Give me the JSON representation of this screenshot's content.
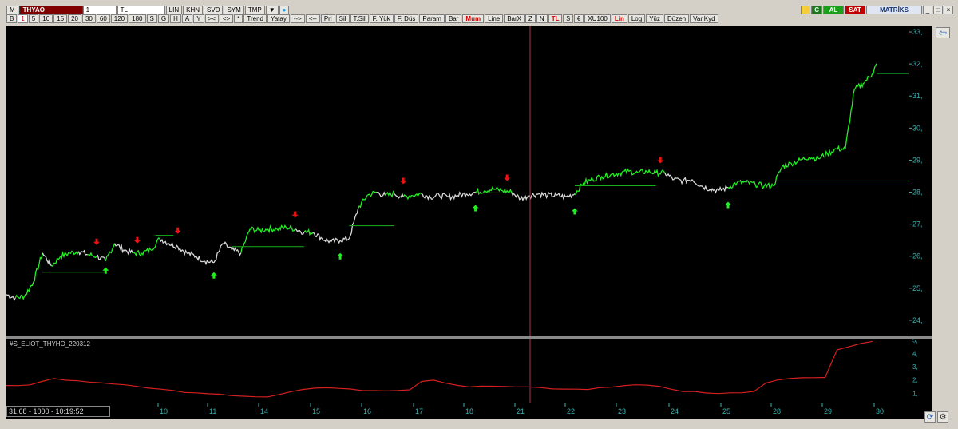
{
  "toolbar": {
    "menu_label": "M",
    "symbol": "THYAO",
    "period": "1",
    "currency": "TL",
    "row1_buttons": [
      "LIN",
      "KHN",
      "SVD",
      "SYM",
      "TMP"
    ],
    "row2_periods": [
      "B",
      "1",
      "5",
      "10",
      "15",
      "20",
      "30",
      "60",
      "120",
      "180",
      "S",
      "G",
      "H",
      "A",
      "Y"
    ],
    "row2_selected": "1",
    "row1_tools": [
      "><",
      "<>",
      "*",
      "Trend",
      "Yatay",
      "-->",
      "<--",
      "Prl",
      "Sil",
      "T.Sil",
      "F. Yük",
      "F. Düş",
      "Param",
      "Bar",
      "Mum",
      "Line",
      "BarX",
      "Z",
      "N",
      "TL",
      "$",
      "€",
      "XU100",
      "Lin",
      "Log",
      "Yüz",
      "Düzen",
      "Var.Kyd"
    ],
    "red_tools": [
      "Mum",
      "TL",
      "Lin"
    ]
  },
  "right_controls": {
    "c_label": "C",
    "al_label": "AL",
    "sat_label": "SAT",
    "brand": "MATRİKS"
  },
  "status_readout": "31,68 - 1000 - 10:19:52",
  "indicator_name": "#S_ELIOT_THYHO_220312",
  "colors": {
    "background": "#000000",
    "price_up": "#22ee22",
    "price_neutral": "#d8d8d8",
    "support_line": "#18b018",
    "indicator": "#d42020",
    "axis_text": "#3ab0b0",
    "crosshair": "#b03050",
    "signal_up": "#22ee22",
    "signal_down": "#ee1111"
  },
  "chart_data": {
    "type": "line",
    "y_axis": {
      "min": 23.5,
      "max": 33.2,
      "ticks": [
        "24,",
        "25,",
        "26,",
        "27,",
        "28,",
        "29,",
        "30,",
        "31,",
        "32,",
        "33,"
      ]
    },
    "x_axis": {
      "ticks": [
        "10",
        "11",
        "14",
        "15",
        "16",
        "17",
        "18",
        "21",
        "22",
        "23",
        "24",
        "25",
        "28",
        "29",
        "30"
      ]
    },
    "price_series": [
      {
        "t": 0,
        "v": 24.8
      },
      {
        "t": 0.01,
        "v": 24.7
      },
      {
        "t": 0.02,
        "v": 24.75
      },
      {
        "t": 0.03,
        "v": 25.2
      },
      {
        "t": 0.04,
        "v": 26.1
      },
      {
        "t": 0.05,
        "v": 25.7
      },
      {
        "t": 0.06,
        "v": 26.0
      },
      {
        "t": 0.07,
        "v": 26.1
      },
      {
        "t": 0.08,
        "v": 26.15
      },
      {
        "t": 0.09,
        "v": 26.05
      },
      {
        "t": 0.1,
        "v": 26.0
      },
      {
        "t": 0.11,
        "v": 25.85
      },
      {
        "t": 0.12,
        "v": 26.4
      },
      {
        "t": 0.13,
        "v": 26.2
      },
      {
        "t": 0.14,
        "v": 26.1
      },
      {
        "t": 0.15,
        "v": 26.1
      },
      {
        "t": 0.16,
        "v": 26.2
      },
      {
        "t": 0.17,
        "v": 26.55
      },
      {
        "t": 0.18,
        "v": 26.4
      },
      {
        "t": 0.19,
        "v": 26.3
      },
      {
        "t": 0.2,
        "v": 26.1
      },
      {
        "t": 0.21,
        "v": 26.0
      },
      {
        "t": 0.22,
        "v": 25.85
      },
      {
        "t": 0.23,
        "v": 25.8
      },
      {
        "t": 0.24,
        "v": 26.4
      },
      {
        "t": 0.25,
        "v": 26.2
      },
      {
        "t": 0.26,
        "v": 26.1
      },
      {
        "t": 0.27,
        "v": 26.85
      },
      {
        "t": 0.28,
        "v": 26.8
      },
      {
        "t": 0.29,
        "v": 26.85
      },
      {
        "t": 0.3,
        "v": 26.85
      },
      {
        "t": 0.31,
        "v": 26.9
      },
      {
        "t": 0.32,
        "v": 26.85
      },
      {
        "t": 0.33,
        "v": 26.75
      },
      {
        "t": 0.34,
        "v": 26.75
      },
      {
        "t": 0.35,
        "v": 26.55
      },
      {
        "t": 0.36,
        "v": 26.45
      },
      {
        "t": 0.37,
        "v": 26.5
      },
      {
        "t": 0.38,
        "v": 26.55
      },
      {
        "t": 0.39,
        "v": 27.5
      },
      {
        "t": 0.4,
        "v": 27.9
      },
      {
        "t": 0.41,
        "v": 28.0
      },
      {
        "t": 0.42,
        "v": 27.9
      },
      {
        "t": 0.43,
        "v": 27.95
      },
      {
        "t": 0.44,
        "v": 27.85
      },
      {
        "t": 0.45,
        "v": 27.9
      },
      {
        "t": 0.46,
        "v": 27.95
      },
      {
        "t": 0.47,
        "v": 27.85
      },
      {
        "t": 0.48,
        "v": 27.9
      },
      {
        "t": 0.49,
        "v": 27.85
      },
      {
        "t": 0.5,
        "v": 27.9
      },
      {
        "t": 0.51,
        "v": 27.95
      },
      {
        "t": 0.52,
        "v": 28.0
      },
      {
        "t": 0.53,
        "v": 28.05
      },
      {
        "t": 0.54,
        "v": 28.1
      },
      {
        "t": 0.55,
        "v": 28.05
      },
      {
        "t": 0.56,
        "v": 28.0
      },
      {
        "t": 0.57,
        "v": 27.8
      },
      {
        "t": 0.58,
        "v": 27.9
      },
      {
        "t": 0.59,
        "v": 27.95
      },
      {
        "t": 0.6,
        "v": 27.9
      },
      {
        "t": 0.61,
        "v": 27.9
      },
      {
        "t": 0.62,
        "v": 27.85
      },
      {
        "t": 0.63,
        "v": 27.95
      },
      {
        "t": 0.64,
        "v": 28.3
      },
      {
        "t": 0.65,
        "v": 28.4
      },
      {
        "t": 0.66,
        "v": 28.5
      },
      {
        "t": 0.67,
        "v": 28.55
      },
      {
        "t": 0.68,
        "v": 28.6
      },
      {
        "t": 0.69,
        "v": 28.65
      },
      {
        "t": 0.7,
        "v": 28.6
      },
      {
        "t": 0.71,
        "v": 28.65
      },
      {
        "t": 0.72,
        "v": 28.6
      },
      {
        "t": 0.73,
        "v": 28.6
      },
      {
        "t": 0.74,
        "v": 28.4
      },
      {
        "t": 0.75,
        "v": 28.35
      },
      {
        "t": 0.76,
        "v": 28.4
      },
      {
        "t": 0.77,
        "v": 28.2
      },
      {
        "t": 0.78,
        "v": 28.1
      },
      {
        "t": 0.79,
        "v": 28.05
      },
      {
        "t": 0.8,
        "v": 28.15
      },
      {
        "t": 0.81,
        "v": 28.3
      },
      {
        "t": 0.82,
        "v": 28.3
      },
      {
        "t": 0.83,
        "v": 28.25
      },
      {
        "t": 0.84,
        "v": 28.2
      },
      {
        "t": 0.85,
        "v": 28.2
      },
      {
        "t": 0.86,
        "v": 28.8
      },
      {
        "t": 0.87,
        "v": 28.9
      },
      {
        "t": 0.88,
        "v": 29.0
      },
      {
        "t": 0.89,
        "v": 29.1
      },
      {
        "t": 0.9,
        "v": 29.05
      },
      {
        "t": 0.91,
        "v": 29.2
      },
      {
        "t": 0.92,
        "v": 29.35
      },
      {
        "t": 0.93,
        "v": 29.35
      },
      {
        "t": 0.94,
        "v": 31.2
      },
      {
        "t": 0.95,
        "v": 31.4
      },
      {
        "t": 0.96,
        "v": 31.7
      },
      {
        "t": 0.965,
        "v": 32.0
      }
    ],
    "support_levels": [
      {
        "t0": 0.04,
        "t1": 0.11,
        "v": 25.5
      },
      {
        "t0": 0.165,
        "t1": 0.185,
        "v": 26.65
      },
      {
        "t0": 0.25,
        "t1": 0.33,
        "v": 26.3
      },
      {
        "t0": 0.38,
        "t1": 0.43,
        "v": 26.95
      },
      {
        "t0": 0.53,
        "t1": 0.56,
        "v": 27.98
      },
      {
        "t0": 0.63,
        "t1": 0.72,
        "v": 28.2
      },
      {
        "t0": 0.8,
        "t1": 1.0,
        "v": 28.35
      },
      {
        "t0": 0.965,
        "t1": 1.0,
        "v": 31.7
      }
    ],
    "signals_up": [
      0.11,
      0.23,
      0.37,
      0.52,
      0.63,
      0.8
    ],
    "signals_down": [
      0.1,
      0.145,
      0.19,
      0.32,
      0.44,
      0.555,
      0.725
    ],
    "indicator": {
      "y_ticks": [
        "1,",
        "2,",
        "3,",
        "4,",
        "5,"
      ],
      "y_min": 0.3,
      "y_max": 5.1,
      "values": [
        1.6,
        1.6,
        1.6,
        1.9,
        2.1,
        2.0,
        1.9,
        1.85,
        1.8,
        1.7,
        1.6,
        1.5,
        1.4,
        1.3,
        1.2,
        1.1,
        1.0,
        0.95,
        0.9,
        0.85,
        0.8,
        0.75,
        0.7,
        0.9,
        1.1,
        1.3,
        1.4,
        1.4,
        1.4,
        1.3,
        1.2,
        1.2,
        1.2,
        1.2,
        1.3,
        1.9,
        2.0,
        1.8,
        1.6,
        1.5,
        1.5,
        1.5,
        1.5,
        1.5,
        1.5,
        1.4,
        1.35,
        1.3,
        1.3,
        1.3,
        1.4,
        1.5,
        1.6,
        1.6,
        1.6,
        1.5,
        1.3,
        1.1,
        1.1,
        1.05,
        1.0,
        1.0,
        1.0,
        1.1,
        1.8,
        2.0,
        2.1,
        2.2,
        2.2,
        2.2,
        4.3,
        4.5,
        4.7,
        4.9
      ]
    }
  }
}
